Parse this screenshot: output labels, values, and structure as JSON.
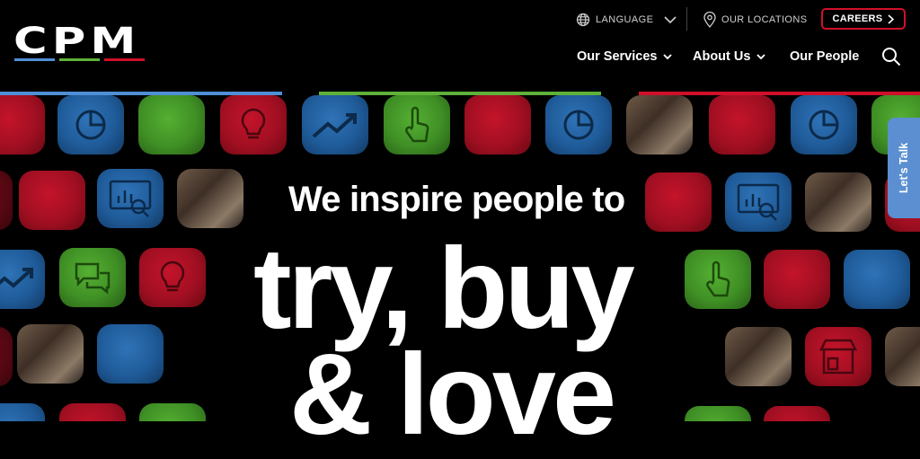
{
  "brand": {
    "name": "CPM",
    "colors": {
      "blue": "#4f8fd6",
      "green": "#5fb13a",
      "red": "#d0102a"
    }
  },
  "utility": {
    "language": "LANGUAGE",
    "locations": "OUR LOCATIONS",
    "careers": "CAREERS"
  },
  "nav": [
    {
      "label": "Our Services",
      "has_dropdown": true
    },
    {
      "label": "About Us",
      "has_dropdown": true
    },
    {
      "label": "Our People",
      "has_dropdown": false
    }
  ],
  "hero": {
    "line1": "We inspire people to",
    "line2": "try, buy",
    "line3": "& love"
  },
  "side_tab": {
    "label": "Let's Talk"
  },
  "icons": [
    "globe-icon",
    "chevron-down-icon",
    "location-pin-icon",
    "chevron-right-icon",
    "search-icon",
    "chart-icon",
    "trend-up-icon",
    "pointer-hand-icon",
    "lightbulb-icon",
    "analytics-monitor-icon",
    "chat-bubbles-icon",
    "storefront-icon"
  ]
}
